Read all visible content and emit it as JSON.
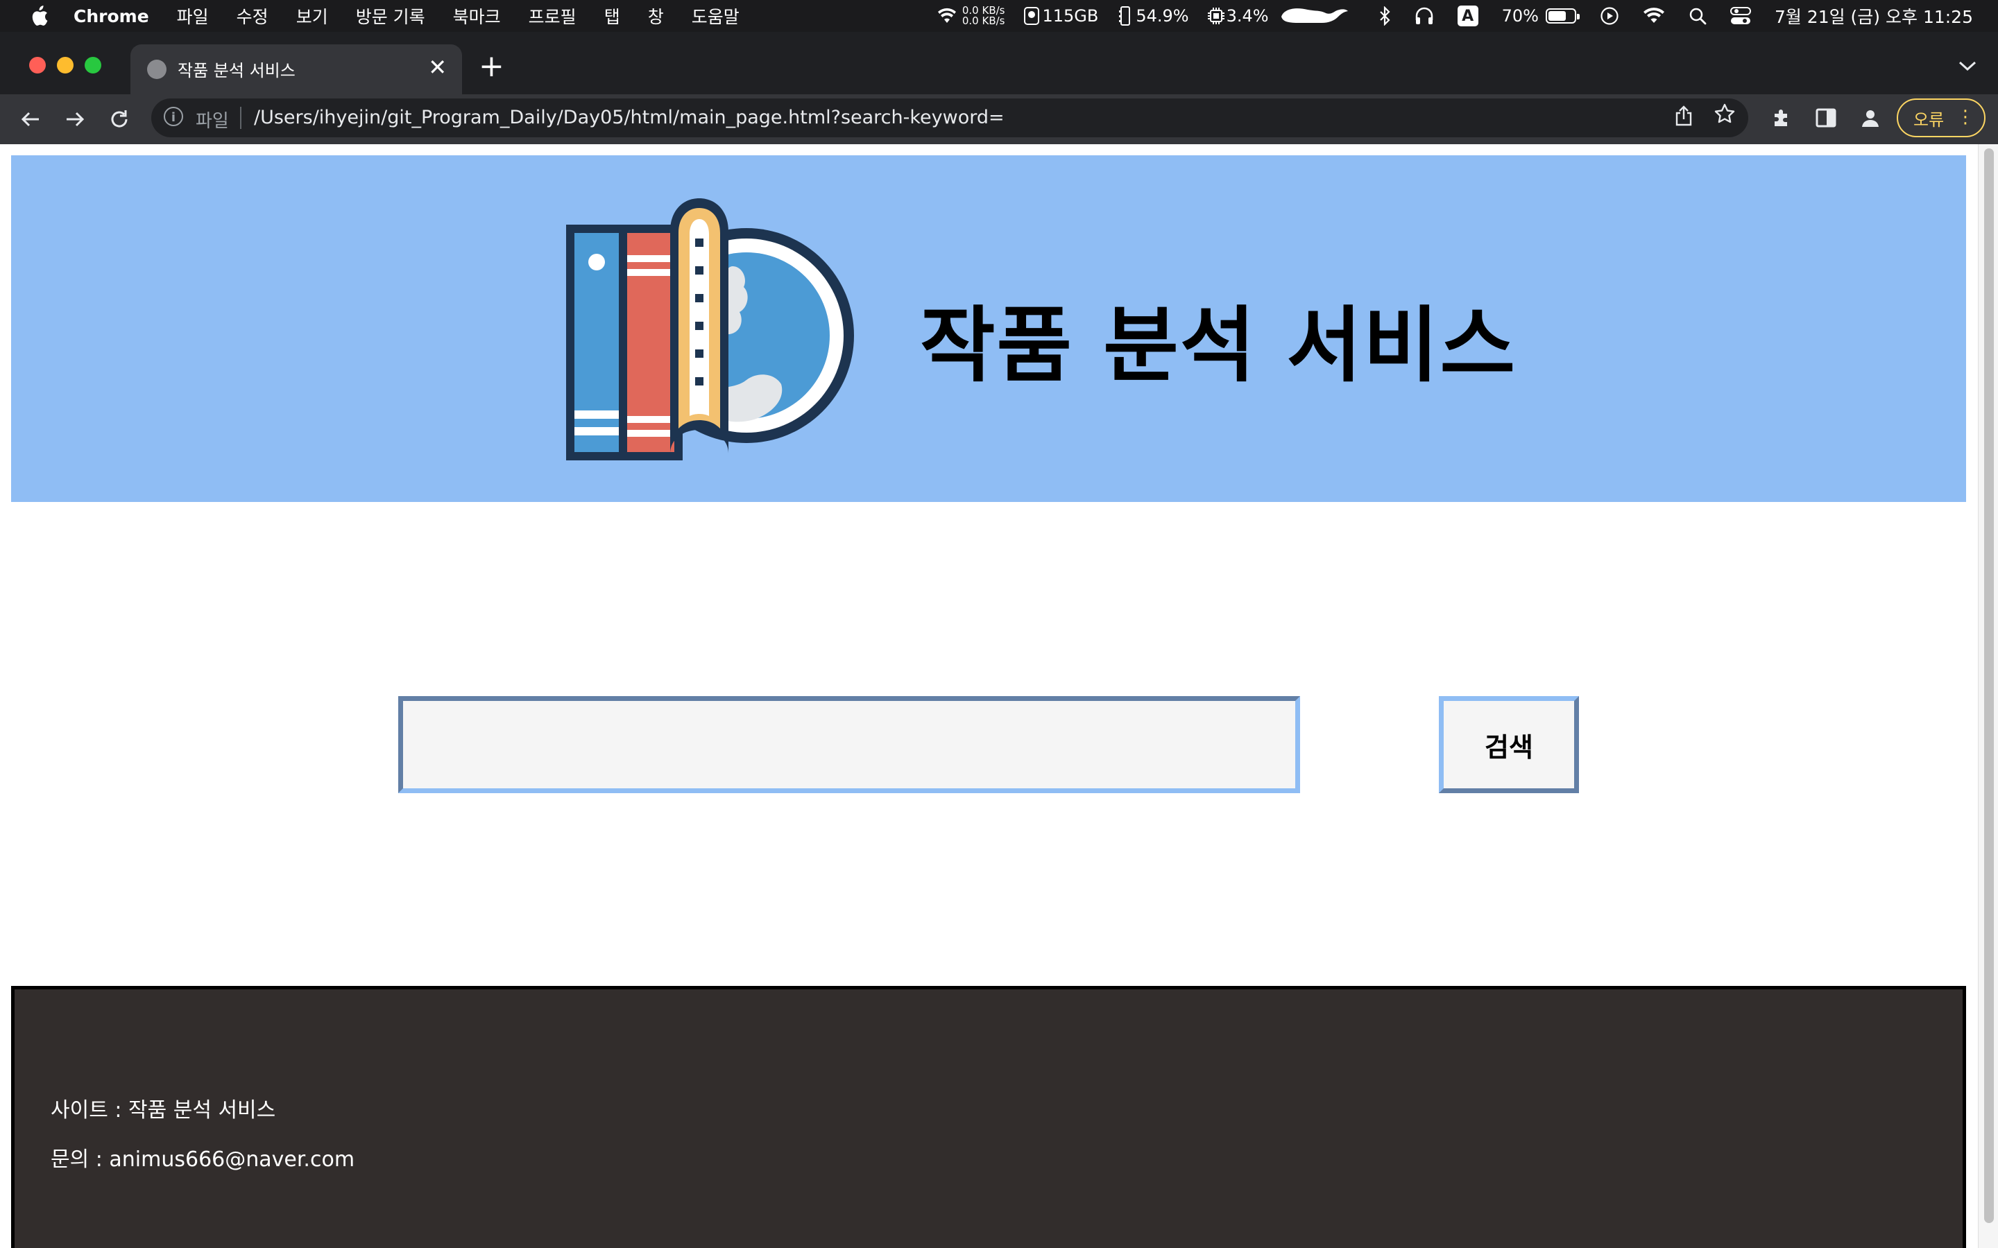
{
  "menubar": {
    "app_name": "Chrome",
    "items": [
      "파일",
      "수정",
      "보기",
      "방문 기록",
      "북마크",
      "프로필",
      "탭",
      "창",
      "도움말"
    ],
    "network_up": "0.0 KB/s",
    "network_down": "0.0 KB/s",
    "disk": "115GB",
    "memory": "54.9%",
    "cpu": "3.4%",
    "input_source": "A",
    "battery_percent": "70%",
    "battery_level": 0.7,
    "datetime": "7월 21일 (금) 오후 11:25",
    "icons": [
      "apple-icon",
      "wifi-icon",
      "disk-icon",
      "memory-icon",
      "cpu-icon",
      "bluetooth-icon",
      "headphones-icon",
      "battery-icon",
      "play-icon",
      "search-icon",
      "control-center-icon"
    ]
  },
  "browser": {
    "tab_title": "작품 분석 서비스",
    "new_tab_symbol": "+",
    "close_symbol": "✕",
    "scheme_label": "파일",
    "url": "/Users/ihyejin/git_Program_Daily/Day05/html/main_page.html?search-keyword=",
    "error_label": "오류",
    "traffic_colors": [
      "#ff5f57",
      "#febc2e",
      "#28c840"
    ]
  },
  "page": {
    "header": {
      "title": "작품 분석 서비스",
      "background": "#8fbdf4"
    },
    "search": {
      "value": "",
      "placeholder": "",
      "button_label": "검색"
    },
    "footer": {
      "site_line": "사이트 : 작품 분석 서비스",
      "contact_line": "문의 : animus666@naver.com",
      "background": "#322d2c"
    }
  }
}
